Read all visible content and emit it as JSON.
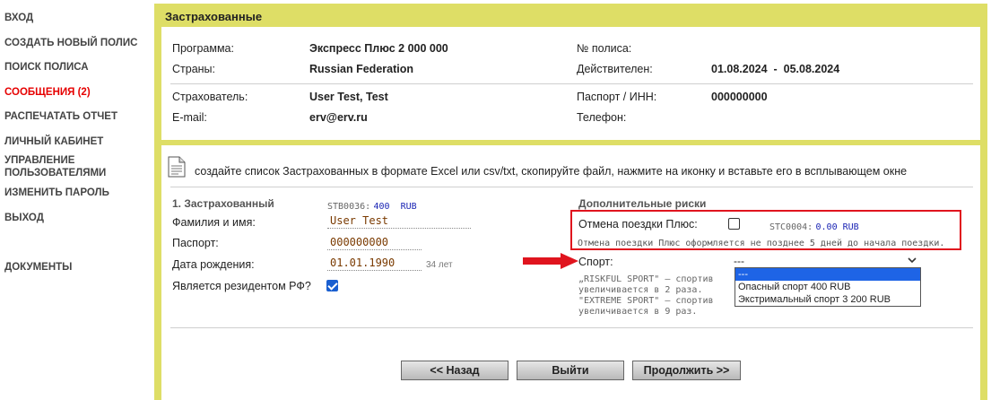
{
  "nav": {
    "items": [
      "ВХОД",
      "СОЗДАТЬ НОВЫЙ ПОЛИС",
      "ПОИСК ПОЛИСА",
      "СООБЩЕНИЯ (2)",
      "РАСПЕЧАТАТЬ ОТЧЕТ",
      "ЛИЧНЫЙ КАБИНЕТ",
      "УПРАВЛЕНИЕ",
      "ПОЛЬЗОВАТЕЛЯМИ",
      "ИЗМЕНИТЬ ПАРОЛЬ",
      "ВЫХОД",
      "ДОКУМЕНТЫ"
    ],
    "active_color": "#e60000"
  },
  "frame_title": "Застрахованные",
  "policy": {
    "program_label": "Программа:",
    "program_value": "Экспресс Плюс 2 000 000",
    "countries_label": "Страны:",
    "countries_value": "Russian Federation",
    "policy_no_label": "№ полиса:",
    "valid_label": "Действителен:",
    "valid_value": "01.08.2024  -  05.08.2024",
    "insurer_label": "Страхователь:",
    "insurer_value": "User Test, Test",
    "email_label": "E-mail:",
    "email_value": "erv@erv.ru",
    "passport_label": "Паспорт / ИНН:",
    "passport_value": "000000000",
    "phone_label": "Телефон:"
  },
  "import_hint": "создайте список Застрахованных в формате Excel или csv/txt, скопируйте файл, нажмите на иконку и вставьте его в всплывающем окне",
  "insured": {
    "title": "1. Застрахованный",
    "code": "STB0036:",
    "amount": "400  RUB",
    "name_label": "Фамилия и имя:",
    "name_value": "User Test",
    "passport_label": "Паспорт:",
    "passport_value": "000000000",
    "birth_label": "Дата рождения:",
    "birth_value": "01.01.1990",
    "age": "34 лет",
    "resident_label": "Является резидентом РФ?",
    "resident_checked": true
  },
  "risks": {
    "title": "Дополнительные риски",
    "cancel_label": "Отмена поездки Плюс:",
    "cancel_checked": false,
    "cancel_code": "STC0004:",
    "cancel_amount": "0.00 RUB",
    "cancel_note": "Отмена поездки Плюс оформляется не позднее 5 дней до начала поездки.",
    "sport_label": "Спорт:",
    "sport_selected": "---",
    "sport_options": [
      "---",
      "Опасный спорт 400 RUB",
      "Экстримальный спорт 3 200 RUB"
    ],
    "sport_note_1": "„RISKFUL SPORT\" – спортив",
    "sport_note_2": "увеличивается в 2 раза.",
    "sport_note_3": "\"EXTREME SPORT\" – спортив",
    "sport_note_4": "увеличивается в 9 раз."
  },
  "buttons": {
    "back": "<< Назад",
    "exit": "Выйти",
    "next": "Продолжить >>"
  },
  "colors": {
    "frame_bg": "#dede66",
    "highlight_border": "#e0141e",
    "arrow": "#e0141e",
    "code_blue": "#1a24b4"
  }
}
